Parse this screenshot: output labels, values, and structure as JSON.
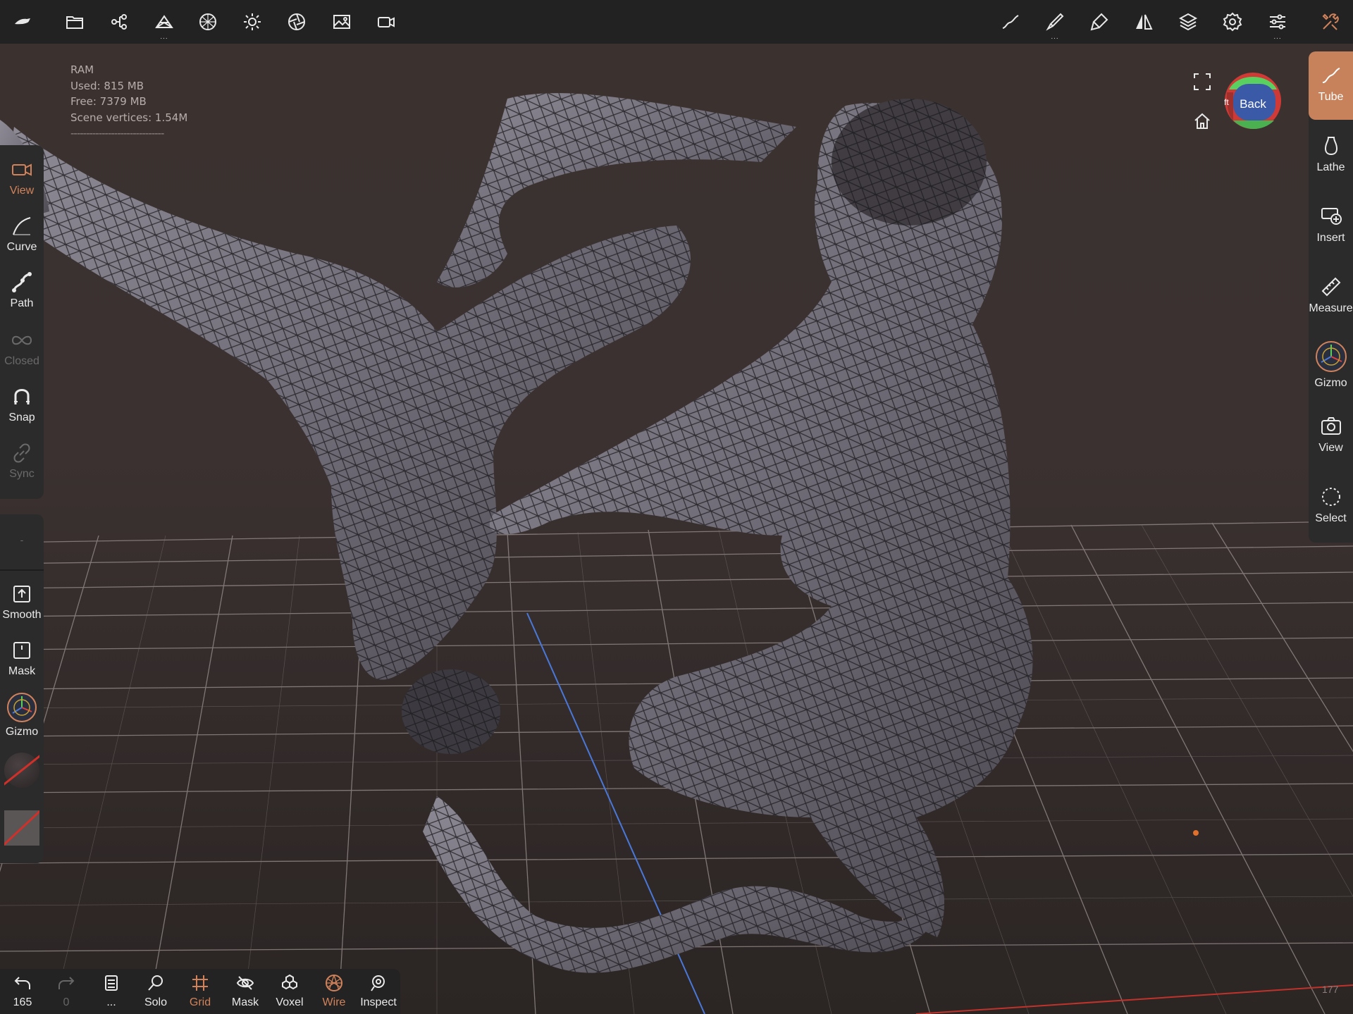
{
  "colors": {
    "accent": "#d2825a",
    "toolbar_bg": "#222222",
    "panel_bg": "#2b2b2b",
    "viewport_bg": "#3a3130",
    "axis_red": "#c0332b",
    "axis_blue": "#4a78d8"
  },
  "top_toolbar": {
    "left_icons": [
      "nomad-logo-icon",
      "folder-icon",
      "scene-graph-icon",
      "mesh-icon",
      "material-icon",
      "light-icon",
      "postprocess-icon",
      "background-image-icon",
      "camera-icon"
    ],
    "right_icons": [
      "stroke-icon",
      "brush-icon",
      "paint-icon",
      "symmetry-icon",
      "layers-icon",
      "settings-icon",
      "sliders-icon",
      "tools-icon"
    ]
  },
  "ram_info": {
    "title": "RAM",
    "used": "Used: 815 MB",
    "free": "Free: 7379 MB",
    "vertices": "Scene vertices: 1.54M",
    "separator": "------------------------------"
  },
  "left_panel": {
    "view": "View",
    "curve": "Curve",
    "path": "Path",
    "closed": "Closed",
    "snap": "Snap",
    "sync": "Sync",
    "blank": "-",
    "smooth": "Smooth",
    "mask": "Mask",
    "gizmo": "Gizmo"
  },
  "right_panel": {
    "tube": "Tube",
    "lathe": "Lathe",
    "insert": "Insert",
    "measure": "Measure",
    "gizmo": "Gizmo",
    "view": "View",
    "select": "Select"
  },
  "view_cube": {
    "face": "Back",
    "side_letter": "ft"
  },
  "bottom_bar": {
    "undo_count": "165",
    "redo_count": "0",
    "menu_label": "...",
    "solo": "Solo",
    "grid": "Grid",
    "mask": "Mask",
    "voxel": "Voxel",
    "wire": "Wire",
    "inspect": "Inspect"
  },
  "corner_number": "177"
}
